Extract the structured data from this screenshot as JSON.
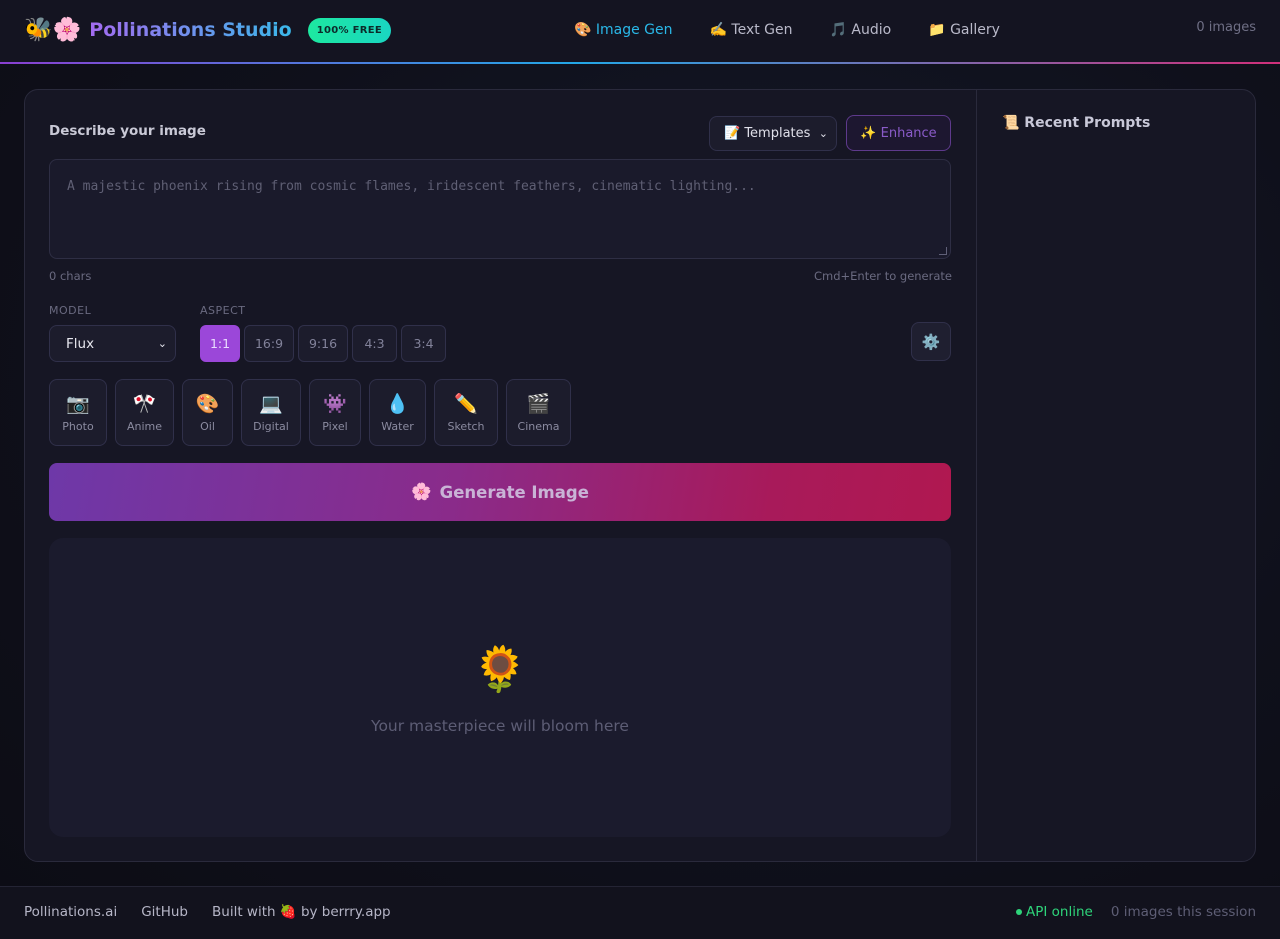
{
  "header": {
    "brand_emoji": "🐝🌸",
    "title": "Pollinations Studio",
    "badge": "100% FREE",
    "nav": [
      {
        "label": "🎨 Image Gen",
        "active": true
      },
      {
        "label": "✍️ Text Gen",
        "active": false
      },
      {
        "label": "🎵 Audio",
        "active": false
      },
      {
        "label": "📁 Gallery",
        "active": false
      }
    ],
    "image_count": "0 images"
  },
  "editor": {
    "describe_label": "Describe your image",
    "templates_label": "📝 Templates",
    "enhance_label": "✨ Enhance",
    "prompt_placeholder": "A majestic phoenix rising from cosmic flames, iridescent feathers, cinematic lighting...",
    "chars": "0 chars",
    "hint": "Cmd+Enter to generate",
    "model_label": "MODEL",
    "model_value": "Flux",
    "aspect_label": "ASPECT",
    "aspects": [
      {
        "label": "1:1",
        "active": true
      },
      {
        "label": "16:9",
        "active": false
      },
      {
        "label": "9:16",
        "active": false
      },
      {
        "label": "4:3",
        "active": false
      },
      {
        "label": "3:4",
        "active": false
      }
    ],
    "settings_icon": "⚙️",
    "styles": [
      {
        "emoji": "📷",
        "label": "Photo"
      },
      {
        "emoji": "🎌",
        "label": "Anime"
      },
      {
        "emoji": "🎨",
        "label": "Oil"
      },
      {
        "emoji": "💻",
        "label": "Digital"
      },
      {
        "emoji": "👾",
        "label": "Pixel"
      },
      {
        "emoji": "💧",
        "label": "Water"
      },
      {
        "emoji": "✏️",
        "label": "Sketch"
      },
      {
        "emoji": "🎬",
        "label": "Cinema"
      }
    ],
    "generate_icon": "🌸",
    "generate_label": "Generate Image",
    "canvas_emoji": "🌻",
    "canvas_text": "Your masterpiece will bloom here"
  },
  "sidebar": {
    "recent_title": "📜 Recent Prompts"
  },
  "footer": {
    "links": [
      "Pollinations.ai",
      "GitHub",
      "Built with 🍓 by berrry.app"
    ],
    "api_status": "API online",
    "session_count": "0 images this session"
  },
  "colors": {
    "accent_purple": "#9b47d9",
    "accent_cyan": "#2ab8e8",
    "status_green": "#2ed47a"
  }
}
